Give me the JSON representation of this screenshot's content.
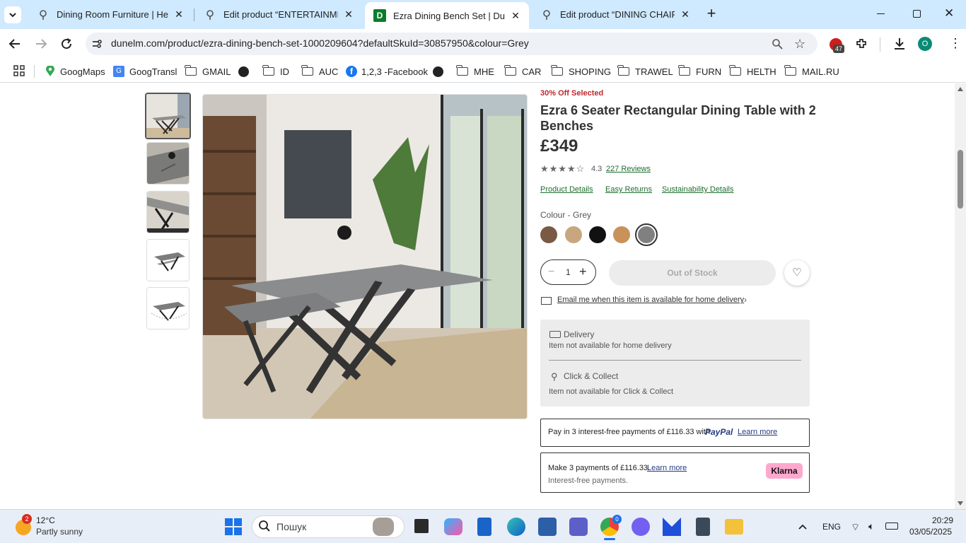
{
  "browser": {
    "tabs": [
      {
        "title": "Dining Room Furniture | Helen's",
        "active": false
      },
      {
        "title": "Edit product “ENTERTAINMENT",
        "active": false
      },
      {
        "title": "Ezra Dining Bench Set | Dunelm",
        "active": true,
        "favicon_letter": "D"
      },
      {
        "title": "Edit product “DINING CHAIRS S",
        "active": false
      }
    ],
    "url": "dunelm.com/product/ezra-dining-bench-set-1000209604?defaultSkuId=30857950&colour=Grey",
    "extension_badge": "47",
    "profile_letter": "O",
    "bookmarks": [
      {
        "label": "GoogMaps",
        "icon": "maps-pin-icon"
      },
      {
        "label": "GoogTransl",
        "icon": "translate-icon"
      },
      {
        "label": "GMAIL",
        "icon": "folder-icon"
      },
      {
        "label": "",
        "icon": "globe-icon"
      },
      {
        "label": "ID",
        "icon": "folder-icon"
      },
      {
        "label": "AUC",
        "icon": "folder-icon"
      },
      {
        "label": "1,2,3 -Facebook",
        "icon": "facebook-icon"
      },
      {
        "label": "",
        "icon": "globe-icon"
      },
      {
        "label": "MHE",
        "icon": "folder-icon"
      },
      {
        "label": "CAR",
        "icon": "folder-icon"
      },
      {
        "label": "SHOPING",
        "icon": "folder-icon"
      },
      {
        "label": "TRAWEL",
        "icon": "folder-icon"
      },
      {
        "label": "FURN",
        "icon": "folder-icon"
      },
      {
        "label": "HELTH",
        "icon": "folder-icon"
      },
      {
        "label": "MAIL.RU",
        "icon": "folder-icon"
      }
    ]
  },
  "product": {
    "offer": "30% Off Selected",
    "title": "Ezra 6 Seater Rectangular Dining Table with 2 Benches",
    "price": "£349",
    "rating_value": "4.3",
    "rating_stars": 4.3,
    "reviews_label": "227 Reviews",
    "links": [
      "Product Details",
      "Easy Returns",
      "Sustainability Details"
    ],
    "colour_label": "Colour - Grey",
    "swatch_colors": [
      "#7a5a44",
      "#c8a77e",
      "#111111",
      "#c8925a",
      "#808080"
    ],
    "selected_swatch": 4,
    "quantity": "1",
    "stock_button": "Out of Stock",
    "email_alert": "Email me when this item is available for home delivery",
    "delivery_title": "Delivery",
    "delivery_text": "Item not available for home delivery",
    "collect_title": "Click & Collect",
    "collect_text": "Item not available for Click & Collect",
    "paypal_text": "Pay in 3 interest-free payments of £116.33 with",
    "paypal_brand": "PayPal",
    "paypal_link": "Learn more",
    "klarna_text": "Make 3 payments of £116.33.",
    "klarna_link": "Learn more",
    "klarna_sub": "Interest-free payments.",
    "klarna_brand": "Klarna"
  },
  "taskbar": {
    "weather_badge": "2",
    "temp": "12°C",
    "condition": "Partly sunny",
    "search_placeholder": "Пошук",
    "lang": "ENG",
    "time": "20:29",
    "date": "03/05/2025",
    "chrome_badge": "0"
  },
  "colors": {
    "accent_green": "#1d6e2d",
    "offer_red": "#c0282d",
    "tab_bg": "#cfe9ff",
    "klarna_pink": "#ffa8cd"
  }
}
